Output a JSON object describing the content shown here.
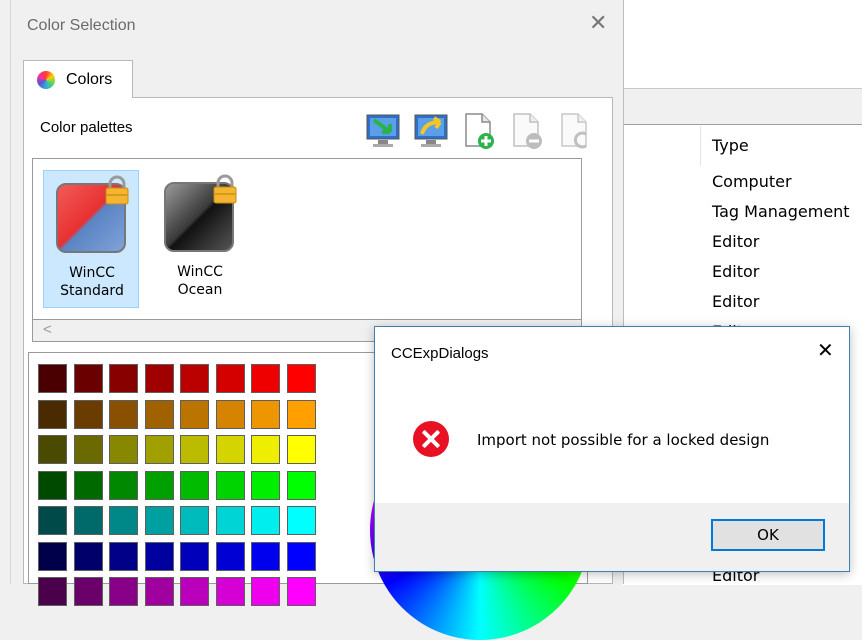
{
  "background_app": {
    "type_column_header": "Type",
    "rows": [
      "Computer",
      "Tag Management",
      "Editor",
      "Editor",
      "Editor",
      "Editor",
      "Editor"
    ]
  },
  "color_dialog": {
    "title": "Color Selection",
    "close_glyph": "✕",
    "tab_label": "Colors",
    "palettes_label": "Color palettes",
    "toolbar_icons": [
      "import-palette-icon",
      "export-palette-icon",
      "add-palette-icon",
      "remove-palette-icon",
      "reset-palette-icon"
    ],
    "palettes": [
      {
        "line1": "WinCC",
        "line2": "Standard",
        "selected": true,
        "locked": true
      },
      {
        "line1": "WinCC",
        "line2": "Ocean",
        "selected": false,
        "locked": true
      }
    ],
    "scroll_left_glyph": "<",
    "swatch_rows": [
      [
        "#4a0000",
        "#6a0000",
        "#880000",
        "#a00000",
        "#bb0000",
        "#d40000",
        "#ee0000",
        "#ff0000"
      ],
      [
        "#4a2a00",
        "#6a3c00",
        "#885000",
        "#a06200",
        "#bb7400",
        "#d48400",
        "#ee9600",
        "#ffa000"
      ],
      [
        "#4a4a00",
        "#6a6a00",
        "#888800",
        "#a0a000",
        "#bbbb00",
        "#d4d400",
        "#eeee00",
        "#ffff00"
      ],
      [
        "#004a00",
        "#006a00",
        "#008800",
        "#00a000",
        "#00bb00",
        "#00d400",
        "#00ee00",
        "#00ff00"
      ],
      [
        "#004a4a",
        "#006a6a",
        "#008888",
        "#00a0a0",
        "#00bbbb",
        "#00d4d4",
        "#00eeee",
        "#00ffff"
      ],
      [
        "#00004a",
        "#00006a",
        "#000088",
        "#0000a0",
        "#0000bb",
        "#0000d4",
        "#0000ee",
        "#0000ff"
      ],
      [
        "#4a004a",
        "#6a006a",
        "#880088",
        "#a000a0",
        "#bb00bb",
        "#d400d4",
        "#ee00ee",
        "#ff00ff"
      ]
    ]
  },
  "message_box": {
    "title": "CCExpDialogs",
    "close_glyph": "✕",
    "icon": "error-icon",
    "message": "Import not possible for a locked design",
    "ok_label": "OK"
  }
}
